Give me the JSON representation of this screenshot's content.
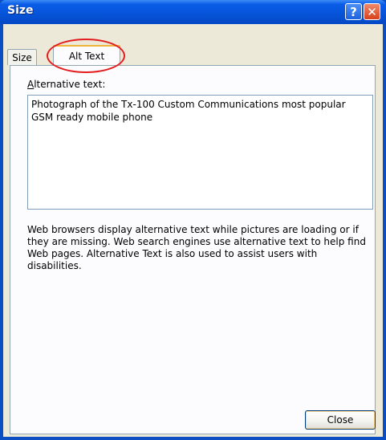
{
  "window": {
    "title": "Size",
    "help_button": "?",
    "close_glyph": "✕"
  },
  "tabs": [
    {
      "label": "Size",
      "selected": false
    },
    {
      "label": "Alt Text",
      "selected": true
    }
  ],
  "alt_text_panel": {
    "label": "Alternative text:",
    "label_mnemonic": "A",
    "value": "Photograph of the Tx-100 Custom Communications most popular GSM ready mobile phone",
    "description": "Web browsers display alternative text while pictures are loading or if they are missing.  Web search engines use alternative text to help find Web pages. Alternative Text is also used to assist users with disabilities."
  },
  "buttons": {
    "close_label": "Close"
  },
  "colors": {
    "titlebar": "#0653d8",
    "dialog_face": "#ece9d8",
    "annotation_ring": "#e31d1d"
  }
}
